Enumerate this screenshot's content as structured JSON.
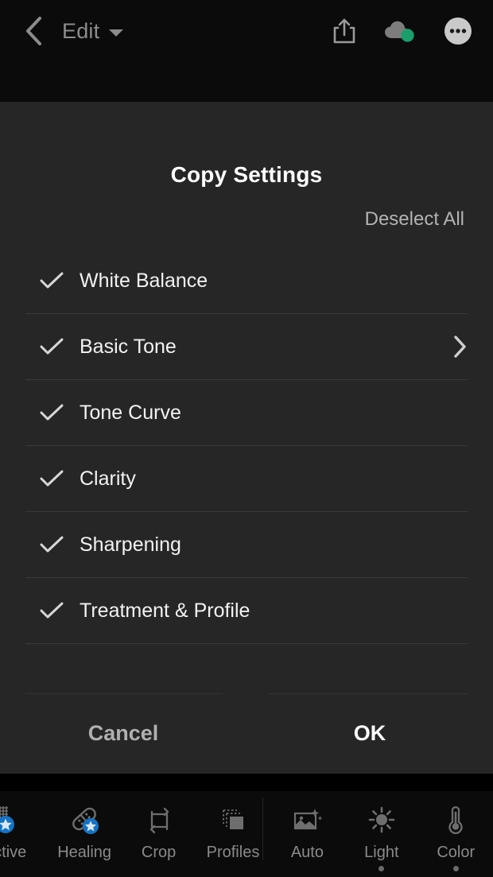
{
  "topbar": {
    "back_icon": "chevron-left-icon",
    "title": "Edit",
    "dropdown_icon": "chevron-down-icon",
    "actions": [
      {
        "name": "share-icon",
        "label": "Share"
      },
      {
        "name": "cloud-sync-icon",
        "label": "Cloud Sync",
        "badge_color": "#1a9e6b"
      },
      {
        "name": "more-options-icon",
        "label": "More Options"
      }
    ]
  },
  "dialog": {
    "title": "Copy Settings",
    "deselect_all": "Deselect All",
    "items": [
      {
        "label": "White Balance",
        "checked": true,
        "has_chevron": false
      },
      {
        "label": "Basic Tone",
        "checked": true,
        "has_chevron": true
      },
      {
        "label": "Tone Curve",
        "checked": true,
        "has_chevron": false
      },
      {
        "label": "Clarity",
        "checked": true,
        "has_chevron": false
      },
      {
        "label": "Sharpening",
        "checked": true,
        "has_chevron": false
      },
      {
        "label": "Treatment & Profile",
        "checked": true,
        "has_chevron": false
      }
    ],
    "cancel_label": "Cancel",
    "ok_label": "OK"
  },
  "bottombar": {
    "items": [
      {
        "label": "ctive",
        "icon": "selective-icon",
        "dot": false,
        "clipped": true
      },
      {
        "label": "Healing",
        "icon": "healing-icon",
        "dot": false,
        "clipped": false
      },
      {
        "label": "Crop",
        "icon": "crop-icon",
        "dot": false,
        "clipped": false
      },
      {
        "label": "Profiles",
        "icon": "profiles-icon",
        "dot": false,
        "clipped": false
      },
      {
        "label": "Auto",
        "icon": "auto-enhance-icon",
        "dot": false,
        "clipped": false
      },
      {
        "label": "Light",
        "icon": "light-sun-icon",
        "dot": true,
        "clipped": false
      },
      {
        "label": "Color",
        "icon": "color-thermometer-icon",
        "dot": true,
        "clipped": false
      }
    ]
  },
  "colors": {
    "topbar_bg": "#0b0b0b",
    "dialog_bg": "#262626",
    "divider": "#3a3a3a",
    "text_primary": "#f2f2f2",
    "text_secondary": "#8c8c8c",
    "accent_badge": "#1a9e6b",
    "star_badge": "#1473c4"
  }
}
